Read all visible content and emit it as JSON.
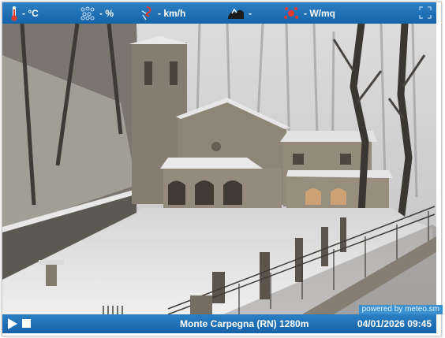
{
  "weather": {
    "temperature": "- °C",
    "humidity": "- %",
    "wind": "- km/h",
    "pressure": "-",
    "radiation": "- W/mq"
  },
  "icons": {
    "temperature": "thermometer-icon",
    "humidity": "droplets-icon",
    "wind": "wind-icon",
    "pressure": "pressure-icon",
    "radiation": "solar-radiation-icon",
    "fullscreen": "fullscreen-icon",
    "play": "play-icon",
    "stop": "stop-icon"
  },
  "colors": {
    "bar": "#1f72b8",
    "icon_red": "#e23a2e"
  },
  "camera": {
    "credit": "powered by meteo.sm",
    "location": "Monte Carpegna (RN) 1280m",
    "timestamp": "04/01/2026 09:45"
  }
}
